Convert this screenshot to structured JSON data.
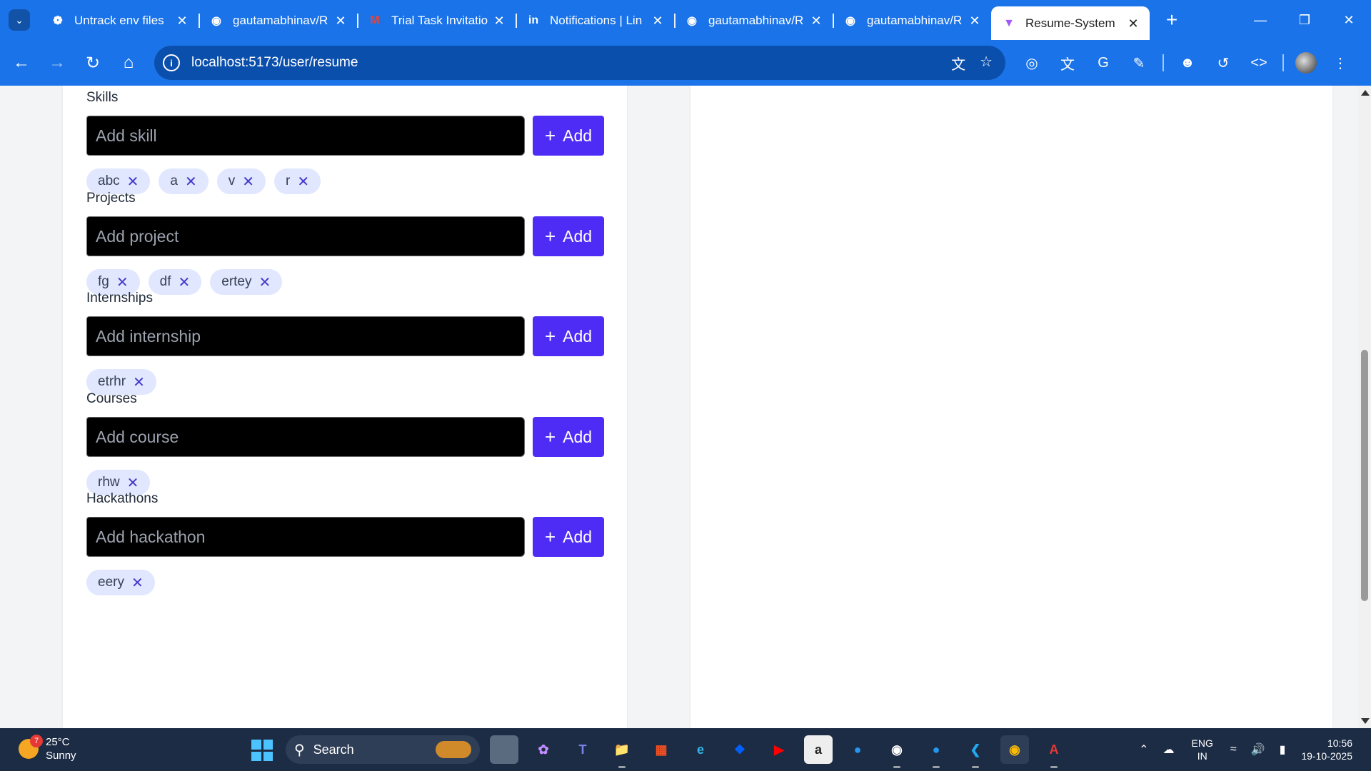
{
  "browser": {
    "tabs": [
      {
        "title": "Untrack env files",
        "favicon": "openai-icon",
        "active": false
      },
      {
        "title": "gautamabhinav/R",
        "favicon": "github-icon",
        "active": false
      },
      {
        "title": "Trial Task Invitatio",
        "favicon": "gmail-icon",
        "active": false
      },
      {
        "title": "Notifications | Lin",
        "favicon": "linkedin-icon",
        "active": false
      },
      {
        "title": "gautamabhinav/R",
        "favicon": "github-icon",
        "active": false
      },
      {
        "title": "gautamabhinav/R",
        "favicon": "github-icon",
        "active": false
      },
      {
        "title": "Resume-System",
        "favicon": "vite-icon",
        "active": true
      }
    ],
    "url": "localhost:5173/user/resume",
    "accent": "#1a73e8"
  },
  "form": {
    "sections": [
      {
        "heading": "Skills",
        "placeholder": "Add skill",
        "add_label": "Add",
        "items": [
          "abc",
          "a",
          "v",
          "r"
        ]
      },
      {
        "heading": "Projects",
        "placeholder": "Add project",
        "add_label": "Add",
        "items": [
          "fg",
          "df",
          "ertey"
        ]
      },
      {
        "heading": "Internships",
        "placeholder": "Add internship",
        "add_label": "Add",
        "items": [
          "etrhr"
        ]
      },
      {
        "heading": "Courses",
        "placeholder": "Add course",
        "add_label": "Add",
        "items": [
          "rhw"
        ]
      },
      {
        "heading": "Hackathons",
        "placeholder": "Add hackathon",
        "add_label": "Add",
        "items": [
          "eery"
        ]
      }
    ],
    "button_color": "#4f2cf5",
    "chip_color": "#e0e7ff"
  },
  "taskbar": {
    "weather_temp": "25°C",
    "weather_desc": "Sunny",
    "weather_badge": "7",
    "search_label": "Search",
    "lang_top": "ENG",
    "lang_bottom": "IN",
    "time": "10:56",
    "date": "19-10-2025"
  }
}
